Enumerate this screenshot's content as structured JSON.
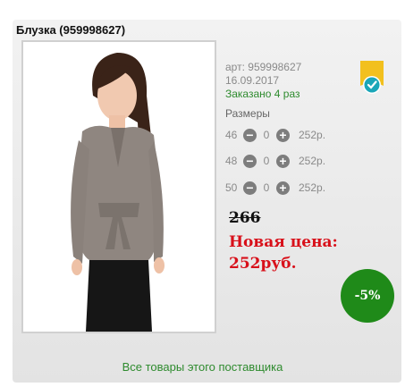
{
  "product": {
    "title": "Блузка (959998627)",
    "article_label": "арт:",
    "article": "959998627",
    "date": "16.09.2017",
    "ordered": "Заказано 4 раз"
  },
  "sizes": {
    "label": "Размеры",
    "rows": [
      {
        "size": "46",
        "qty": "0",
        "price": "252р."
      },
      {
        "size": "48",
        "qty": "0",
        "price": "252р."
      },
      {
        "size": "50",
        "qty": "0",
        "price": "252р."
      }
    ],
    "minus": "−",
    "plus": "+"
  },
  "pricing": {
    "old_price": "266",
    "new_price": "Новая цена: 252руб.",
    "discount": "-5%"
  },
  "footer": {
    "supplier_link": "Все товары этого поставщика"
  },
  "colors": {
    "accent_green": "#2e8b2e",
    "price_red": "#d8101a",
    "badge_green": "#1f8a19",
    "ribbon_yellow": "#f2c01e",
    "check_teal": "#1ba6b8"
  },
  "icons": [
    "product-photo",
    "verified-ribbon-icon",
    "minus-icon",
    "plus-icon"
  ]
}
